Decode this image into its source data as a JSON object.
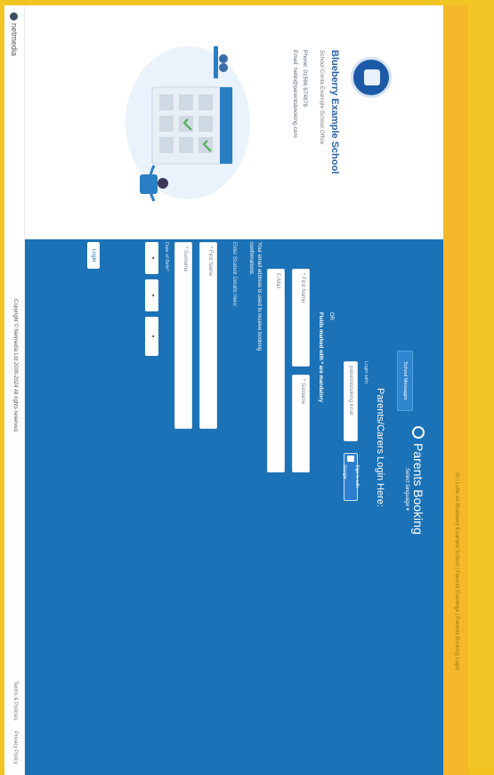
{
  "breadcrumb": "ID | Lutte en Blueberry Example School | Parents Evenings | Parents Booking Login",
  "school": {
    "name": "Blueberry Example School",
    "sub": "School Conta Example School Office",
    "phone": "Phone: 01566 674876",
    "email": "Email: hello@parentsbooking.com"
  },
  "brand": {
    "title": "Parents Booking",
    "school_messages": "School Messages",
    "select_language": "Select language ▾"
  },
  "login": {
    "heading": "Parents/Carers Login Here:",
    "login_with": "Login with:",
    "parentsbooking_placeholder": "parentsbooking.local",
    "google_button": "Sign in with Google",
    "or": "OR",
    "mandatory_note": "Fields marked with * are mandatory",
    "first_name_placeholder": "* First Name",
    "surname_placeholder": "* Surname",
    "email_placeholder": "E-Mail",
    "email_note_line1": "Your email address is used to receive booking",
    "email_note_line2": "confirmations.",
    "student_header": "Enter Student Details Here:",
    "student_first_placeholder": "* First Name",
    "student_surname_placeholder": "* Surname",
    "dob_label": "Date of Birth*",
    "dob_day": "▾",
    "dob_month": "▾",
    "dob_year": "▾",
    "login_button": "Login"
  },
  "footer": {
    "brand": "netmedia",
    "copyright": "Copyright © Netmedia Ltd 2009-2024 All rights reserved.",
    "terms": "Terms & Policies",
    "privacy": "Privacy Policy"
  },
  "colors": {
    "accent": "#1c72b6",
    "topbar": "#f5b82a",
    "school_name": "#2a62a8"
  }
}
